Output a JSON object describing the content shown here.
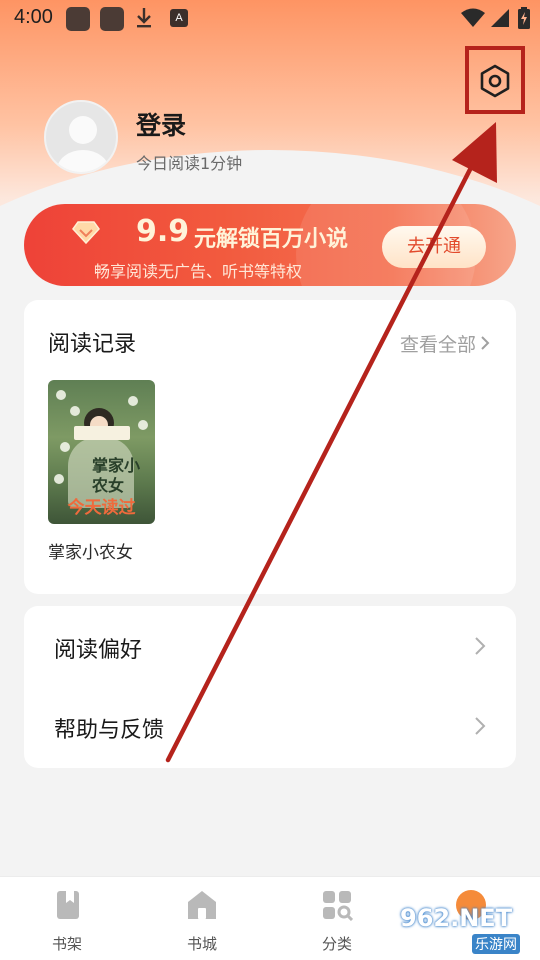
{
  "status_bar": {
    "time": "4:00",
    "a_icon_letter": "A"
  },
  "profile": {
    "login_label": "登录",
    "read_today": "今日阅读1分钟"
  },
  "vip_banner": {
    "price": "9.9",
    "title": "元解锁百万小说",
    "subtitle": "畅享阅读无广告、听书等特权",
    "button_label": "去开通"
  },
  "history": {
    "title": "阅读记录",
    "view_all": "查看全部",
    "books": [
      {
        "name": "掌家小农女",
        "cover_title": "掌家小农女",
        "cover_badge": "今天读过"
      }
    ]
  },
  "menu": {
    "items": [
      {
        "label": "阅读偏好"
      },
      {
        "label": "帮助与反馈"
      }
    ]
  },
  "bottom_nav": {
    "items": [
      {
        "label": "书架",
        "icon": "bookshelf-icon"
      },
      {
        "label": "书城",
        "icon": "bookstore-icon"
      },
      {
        "label": "分类",
        "icon": "category-icon"
      }
    ]
  },
  "watermark": {
    "top": "962.NET",
    "bottom": "乐游网"
  },
  "colors": {
    "accent": "#ee4238",
    "annotation": "#b5231c",
    "header_top": "#fe9463"
  }
}
